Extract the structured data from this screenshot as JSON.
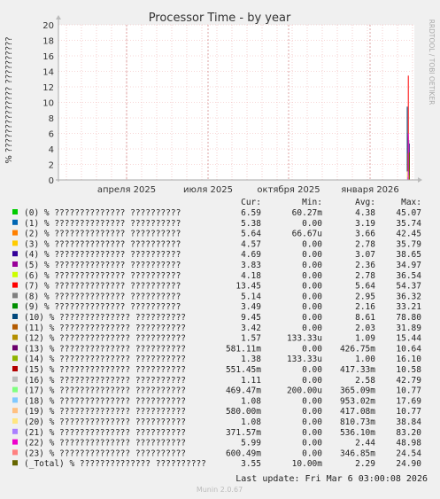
{
  "title": "Processor Time - by year",
  "ylabel": "% ?????????????? ??????????",
  "side_label": "RRDTOOL / TOBI OETIKER",
  "footer": "Munin 2.0.67",
  "last_update": "Last update: Fri Mar  6 03:00:08 2026",
  "legend_headers": {
    "cur": "Cur:",
    "min": "Min:",
    "avg": "Avg:",
    "max": "Max:"
  },
  "chart_data": {
    "type": "line",
    "title": "Processor Time - by year",
    "ylabel": "% ?????????????? ??????????",
    "ylim": [
      0,
      20
    ],
    "yticks": [
      0,
      2,
      4,
      6,
      8,
      10,
      12,
      14,
      16,
      18,
      20
    ],
    "xticks": [
      "апреля 2025",
      "июля 2025",
      "октября 2025",
      "января 2026"
    ],
    "grid": true,
    "series": [
      {
        "name": "(0) % ?????????????? ??????????",
        "color": "#00cc00",
        "cur": "6.59",
        "min": "60.27m",
        "avg": "4.38",
        "max": "45.07"
      },
      {
        "name": "(1) % ?????????????? ??????????",
        "color": "#0066b3",
        "cur": "5.38",
        "min": "0.00",
        "avg": "3.19",
        "max": "35.74"
      },
      {
        "name": "(2) % ?????????????? ??????????",
        "color": "#ff8000",
        "cur": "5.64",
        "min": "66.67u",
        "avg": "3.66",
        "max": "42.45"
      },
      {
        "name": "(3) % ?????????????? ??????????",
        "color": "#ffcc00",
        "cur": "4.57",
        "min": "0.00",
        "avg": "2.78",
        "max": "35.79"
      },
      {
        "name": "(4) % ?????????????? ??????????",
        "color": "#330099",
        "cur": "4.69",
        "min": "0.00",
        "avg": "3.07",
        "max": "38.65"
      },
      {
        "name": "(5) % ?????????????? ??????????",
        "color": "#990099",
        "cur": "3.83",
        "min": "0.00",
        "avg": "2.36",
        "max": "34.97"
      },
      {
        "name": "(6) % ?????????????? ??????????",
        "color": "#ccff00",
        "cur": "4.18",
        "min": "0.00",
        "avg": "2.78",
        "max": "36.54"
      },
      {
        "name": "(7) % ?????????????? ??????????",
        "color": "#ff0000",
        "cur": "13.45",
        "min": "0.00",
        "avg": "5.64",
        "max": "54.37"
      },
      {
        "name": "(8) % ?????????????? ??????????",
        "color": "#808080",
        "cur": "5.14",
        "min": "0.00",
        "avg": "2.95",
        "max": "36.32"
      },
      {
        "name": "(9) % ?????????????? ??????????",
        "color": "#008f00",
        "cur": "3.49",
        "min": "0.00",
        "avg": "2.16",
        "max": "33.21"
      },
      {
        "name": "(10) % ?????????????? ??????????",
        "color": "#00487d",
        "cur": "9.45",
        "min": "0.00",
        "avg": "8.61",
        "max": "78.80"
      },
      {
        "name": "(11) % ?????????????? ??????????",
        "color": "#b35a00",
        "cur": "3.42",
        "min": "0.00",
        "avg": "2.03",
        "max": "31.89"
      },
      {
        "name": "(12) % ?????????????? ??????????",
        "color": "#b38f00",
        "cur": "1.57",
        "min": "133.33u",
        "avg": "1.09",
        "max": "15.44"
      },
      {
        "name": "(13) % ?????????????? ??????????",
        "color": "#6b006b",
        "cur": "581.11m",
        "min": "0.00",
        "avg": "426.75m",
        "max": "10.64"
      },
      {
        "name": "(14) % ?????????????? ??????????",
        "color": "#8fb300",
        "cur": "1.38",
        "min": "133.33u",
        "avg": "1.00",
        "max": "16.10"
      },
      {
        "name": "(15) % ?????????????? ??????????",
        "color": "#b30000",
        "cur": "551.45m",
        "min": "0.00",
        "avg": "417.33m",
        "max": "10.58"
      },
      {
        "name": "(16) % ?????????????? ??????????",
        "color": "#bebebe",
        "cur": "1.11",
        "min": "0.00",
        "avg": "2.58",
        "max": "42.79"
      },
      {
        "name": "(17) % ?????????????? ??????????",
        "color": "#80ff80",
        "cur": "469.47m",
        "min": "200.00u",
        "avg": "365.09m",
        "max": "10.77"
      },
      {
        "name": "(18) % ?????????????? ??????????",
        "color": "#80c9ff",
        "cur": "1.08",
        "min": "0.00",
        "avg": "953.02m",
        "max": "17.69"
      },
      {
        "name": "(19) % ?????????????? ??????????",
        "color": "#ffc080",
        "cur": "580.00m",
        "min": "0.00",
        "avg": "417.08m",
        "max": "10.77"
      },
      {
        "name": "(20) % ?????????????? ??????????",
        "color": "#ffe680",
        "cur": "1.08",
        "min": "0.00",
        "avg": "810.73m",
        "max": "38.84"
      },
      {
        "name": "(21) % ?????????????? ??????????",
        "color": "#aa80ff",
        "cur": "371.57m",
        "min": "0.00",
        "avg": "536.10m",
        "max": "83.20"
      },
      {
        "name": "(22) % ?????????????? ??????????",
        "color": "#ee00cc",
        "cur": "5.99",
        "min": "0.00",
        "avg": "2.44",
        "max": "48.98"
      },
      {
        "name": "(23) % ?????????????? ??????????",
        "color": "#ff8080",
        "cur": "600.49m",
        "min": "0.00",
        "avg": "346.85m",
        "max": "24.54"
      },
      {
        "name": "(_Total) % ?????????????? ??????????",
        "color": "#666600",
        "cur": "3.55",
        "min": "10.00m",
        "avg": "2.29",
        "max": "24.90"
      }
    ]
  }
}
